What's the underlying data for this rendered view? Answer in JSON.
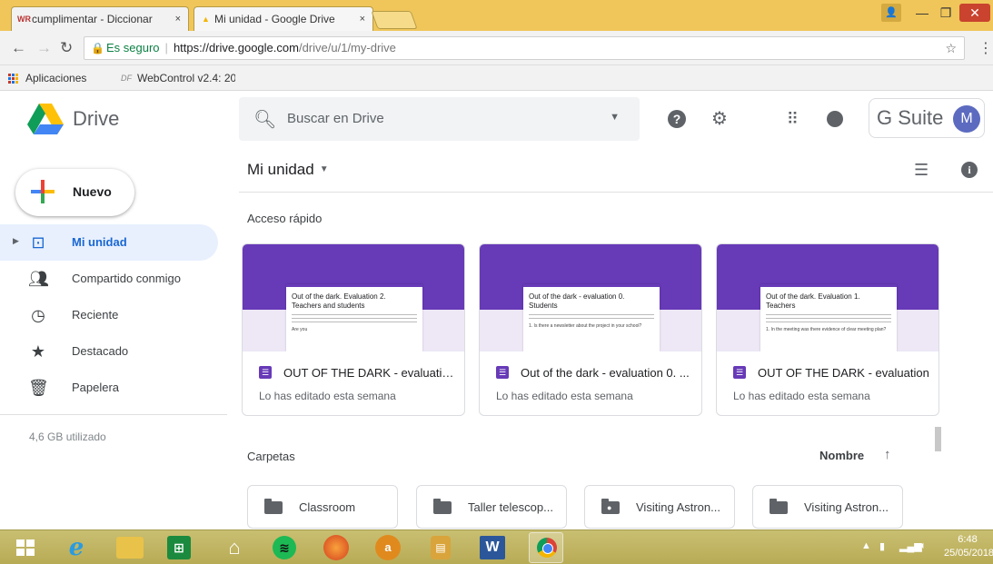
{
  "browser": {
    "tabs": [
      {
        "title": "cumplimentar - Diccionar",
        "favicon": "WR",
        "close": "×"
      },
      {
        "title": "Mi unidad - Google Drive",
        "favicon": "▲",
        "close": "×"
      }
    ],
    "url": {
      "secure_label": "Es seguro",
      "host": "https://drive.google.com",
      "path": "/drive/u/1/my-drive"
    },
    "bookmarks": [
      {
        "label": "Aplicaciones"
      },
      {
        "prefix": "DF",
        "label": "WebControl v2.4: 20"
      }
    ]
  },
  "drive": {
    "title": "Drive",
    "search_placeholder": "Buscar en Drive",
    "gsuite_label": "G Suite",
    "avatar_initial": "M"
  },
  "sidebar": {
    "new_label": "Nuevo",
    "items": [
      {
        "label": "Mi unidad",
        "icon": "drive-icon",
        "active": true
      },
      {
        "label": "Compartido conmigo",
        "icon": "people-icon",
        "active": false
      },
      {
        "label": "Reciente",
        "icon": "clock-icon",
        "active": false
      },
      {
        "label": "Destacado",
        "icon": "star-icon",
        "active": false
      },
      {
        "label": "Papelera",
        "icon": "trash-icon",
        "active": false
      }
    ],
    "storage": "4,6 GB utilizado"
  },
  "main": {
    "title": "Mi unidad",
    "quick_access_title": "Acceso rápido",
    "quick_access": [
      {
        "name": "OUT OF THE DARK - evaluatio...",
        "subtitle": "Lo has editado esta semana",
        "preview_title": "Out of the dark. Evaluation 2. Teachers and students",
        "preview_q": "Are you"
      },
      {
        "name": "Out of the dark - evaluation 0. ...",
        "subtitle": "Lo has editado esta semana",
        "preview_title": "Out of the dark - evaluation 0. Students",
        "preview_q": "1. Is there a newsletter about the project in your school?"
      },
      {
        "name": "OUT OF THE DARK - evaluation",
        "subtitle": "Lo has editado esta semana",
        "preview_title": "Out of the dark. Evaluation 1. Teachers",
        "preview_q": "1. In the meeting was there evidence of clear meeting plan?"
      }
    ],
    "folders_title": "Carpetas",
    "sort_label": "Nombre",
    "sort_arrow": "↑",
    "folders": [
      {
        "name": "Classroom",
        "shared": false
      },
      {
        "name": "Taller telescop...",
        "shared": false
      },
      {
        "name": "Visiting Astron...",
        "shared": true
      },
      {
        "name": "Visiting Astron...",
        "shared": false
      }
    ]
  },
  "taskbar": {
    "time": "6:48",
    "date": "25/05/2018"
  },
  "colors": {
    "accent": "#1967d2",
    "forms_purple": "#673ab7",
    "title_bar": "#f0c65a",
    "taskbar": "#c0b564"
  }
}
